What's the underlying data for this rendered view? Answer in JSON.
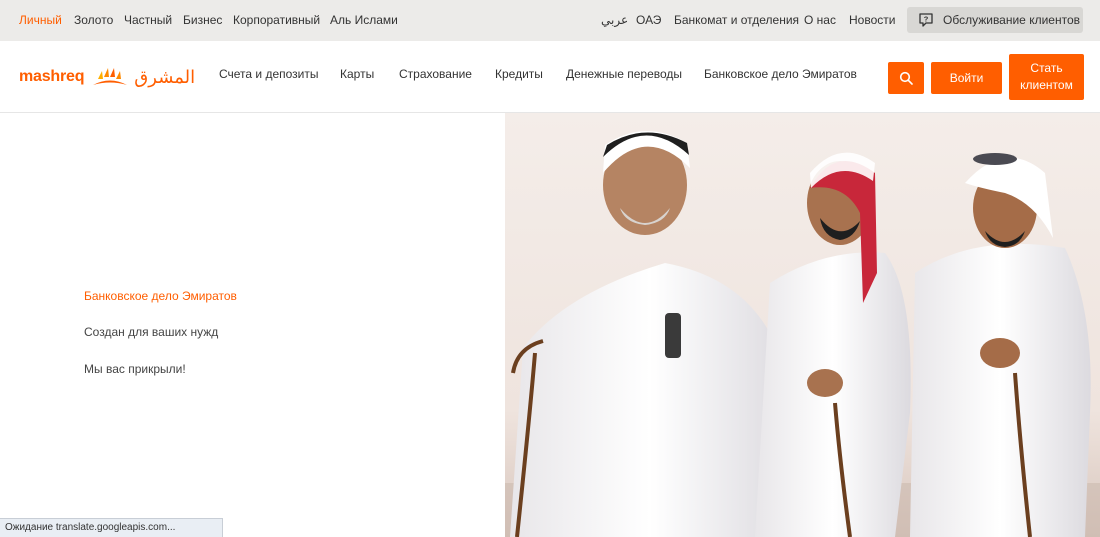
{
  "topbar": {
    "segments": [
      "Личный",
      "Золото",
      "Частный",
      "Бизнес",
      "Корпоративный",
      "Аль Ислами"
    ],
    "right_links": [
      "عربي",
      "ОАЭ",
      "Банкомат и отделения",
      "О нас",
      "Новости"
    ],
    "customer_service": "Обслуживание клиентов"
  },
  "header": {
    "logo_latin": "mashreq",
    "logo_arabic": "المشرق",
    "nav": [
      "Счета и депозиты",
      "Карты",
      "Страхование",
      "Кредиты",
      "Денежные переводы",
      "Банковское дело Эмиратов"
    ],
    "login": "Войти",
    "become_client_line1": "Стать",
    "become_client_line2": "клиентом"
  },
  "hero": {
    "items": [
      "Банковское дело Эмиратов",
      "Создан для ваших нужд",
      "Мы вас прикрыли!"
    ]
  },
  "status_text": "Ожидание translate.googleapis.com...",
  "colors": {
    "accent": "#ff5e00",
    "topbar_bg": "#ecebe9"
  },
  "icons": {
    "search": "search-icon",
    "customer_service": "help-chat-icon",
    "logo_mark": "mashreq-sun-icon"
  }
}
